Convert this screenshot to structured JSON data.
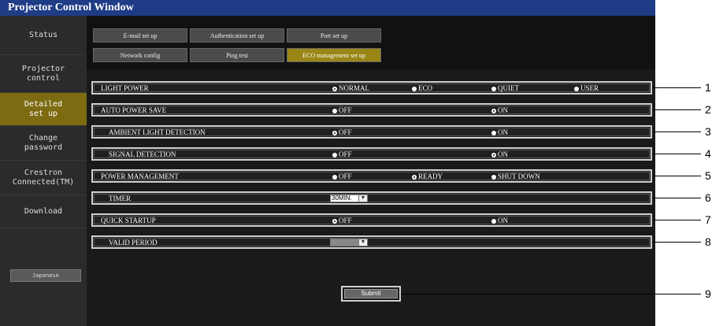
{
  "window": {
    "title": "Projector Control Window"
  },
  "sidebar": {
    "items": [
      {
        "label": "Status"
      },
      {
        "label": "Projector\ncontrol"
      },
      {
        "label": "Detailed\nset up"
      },
      {
        "label": "Change\npassword"
      },
      {
        "label": "Crestron\nConnected(TM)"
      },
      {
        "label": "Download"
      }
    ],
    "language_button": "Japanese"
  },
  "tabs": {
    "row1": [
      "E-mail set up",
      "Authentication set up",
      "Port set up"
    ],
    "row2": [
      "Network config",
      "Ping test",
      "ECO management set up"
    ]
  },
  "settings": {
    "light_power": {
      "label": "LIGHT POWER",
      "options": [
        "NORMAL",
        "ECO",
        "QUIET",
        "USER"
      ],
      "selected": "NORMAL"
    },
    "auto_power_save": {
      "label": "AUTO POWER SAVE",
      "options": [
        "OFF",
        "ON"
      ],
      "selected": "ON"
    },
    "ambient_light": {
      "label": "AMBIENT LIGHT DETECTION",
      "options": [
        "OFF",
        "ON"
      ],
      "selected": "OFF"
    },
    "signal_detection": {
      "label": "SIGNAL DETECTION",
      "options": [
        "OFF",
        "ON"
      ],
      "selected": "ON"
    },
    "power_management": {
      "label": "POWER MANAGEMENT",
      "options": [
        "OFF",
        "READY",
        "SHUT DOWN"
      ],
      "selected": "READY"
    },
    "timer": {
      "label": "TIMER",
      "value": "30MIN."
    },
    "quick_startup": {
      "label": "QUICK STARTUP",
      "options": [
        "OFF",
        "ON"
      ],
      "selected": "OFF"
    },
    "valid_period": {
      "label": "VALID PERIOD",
      "value": ""
    }
  },
  "submit_label": "Submit",
  "callouts": [
    "1",
    "2",
    "3",
    "4",
    "5",
    "6",
    "7",
    "8",
    "9"
  ]
}
